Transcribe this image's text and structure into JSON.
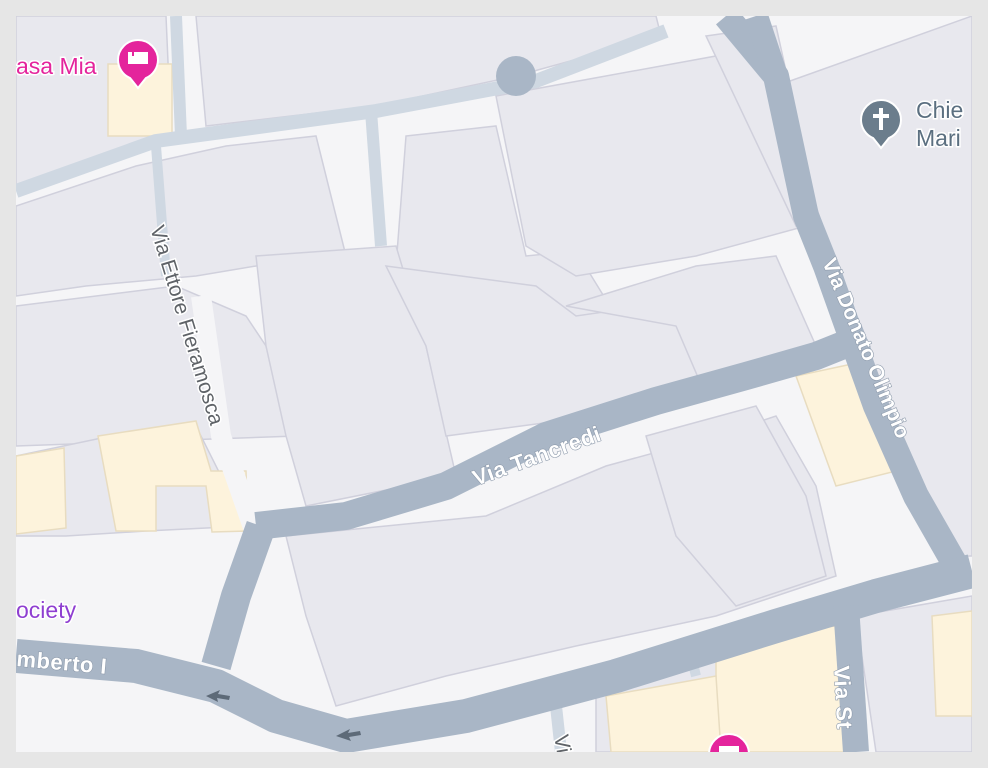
{
  "map": {
    "colors": {
      "background": "#f5f5f7",
      "building": "#e8e8ee",
      "building_outline": "#d0d0dc",
      "road_major": "#a9b6c6",
      "road_minor": "#cfd8e2",
      "highlight_building": "#fdf3dc",
      "hotel_pin": "#e4249c",
      "church_pin": "#6b7d8c"
    },
    "streets": {
      "via_tancredi": "Via Tancredi",
      "via_ettore_fieramosca": "Via Ettore Fieramosca",
      "via_donato_olimpio": "Via Donato Olimpio",
      "umberto": "mberto I",
      "via_st": "Via St",
      "via_partial": "Vi"
    },
    "pois": {
      "casa_mia": {
        "label": "asa Mia",
        "icon": "hotel-bed-icon"
      },
      "church": {
        "label_line1": "Chie",
        "label_line2": "Mari",
        "icon": "church-cross-icon"
      },
      "society": {
        "label": "ociety"
      },
      "hotel_bottom": {
        "icon": "hotel-bed-icon"
      }
    }
  }
}
